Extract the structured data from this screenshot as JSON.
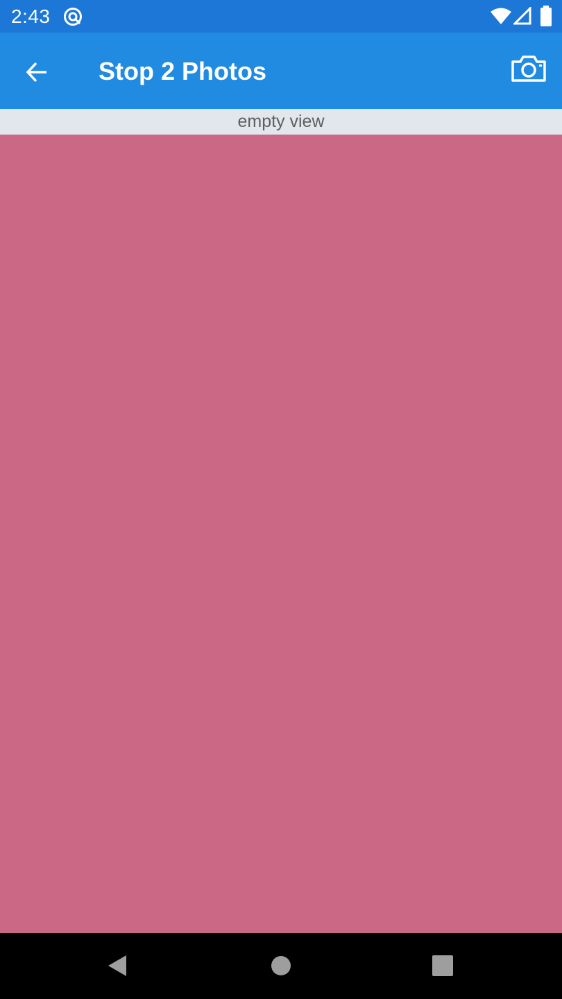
{
  "status_bar": {
    "time": "2:43",
    "icons": [
      "app-notification-icon",
      "wifi-icon",
      "signal-icon",
      "battery-icon"
    ]
  },
  "app_bar": {
    "title": "Stop 2 Photos",
    "back_icon": "arrow-back-icon",
    "action_icon": "camera-icon"
  },
  "empty_view": {
    "label": "empty view"
  },
  "navigation_bar": {
    "buttons": [
      "back-triangle-icon",
      "home-circle-icon",
      "recents-square-icon"
    ]
  },
  "colors": {
    "status_bar": "#1d77d6",
    "app_bar": "#218ae1",
    "banner": "#e1e7ed",
    "content": "#ca6886",
    "nav_bar": "#000000",
    "nav_icons": "#9e9e9e"
  }
}
